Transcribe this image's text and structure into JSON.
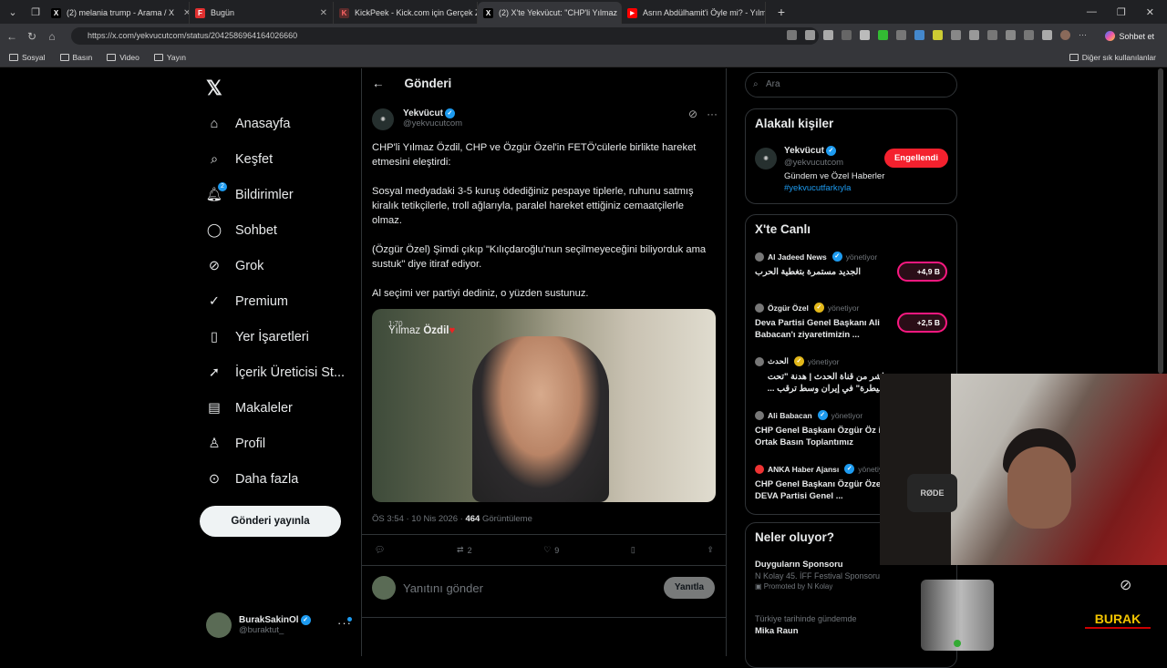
{
  "browser": {
    "tabs": [
      {
        "label": "(2) melania trump - Arama / X",
        "fav": "X"
      },
      {
        "label": "Bugün",
        "fav": "F"
      },
      {
        "label": "KickPeek - Kick.com için Gerçek Za",
        "fav": "K"
      },
      {
        "label": "(2) X'te Yekvücut: \"CHP'li Yılmaz",
        "fav": "X"
      },
      {
        "label": "Asrın Abdülhamit'i Öyle mi? - Yılm",
        "fav": "▶"
      }
    ],
    "url": "https://x.com/yekvucutcom/status/2042586964164026660",
    "chat_label": "Sohbet et",
    "bookmarks": [
      "Sosyal",
      "Basın",
      "Video",
      "Yayın"
    ],
    "bookmarks_other": "Diğer sık kullanılanlar"
  },
  "nav": {
    "items": [
      "Anasayfa",
      "Keşfet",
      "Bildirimler",
      "Sohbet",
      "Grok",
      "Premium",
      "Yer İşaretleri",
      "İçerik Üreticisi St...",
      "Makaleler",
      "Profil",
      "Daha fazla"
    ],
    "notif_badge": "2",
    "post_button": "Gönderi yayınla",
    "user_name": "BurakSakinOl",
    "user_handle": "@buraktut_"
  },
  "post": {
    "header": "Gönderi",
    "author_name": "Yekvücut",
    "author_handle": "@yekvucutcom",
    "paragraphs": [
      "CHP'li Yılmaz Özdil, CHP ve Özgür Özel'in FETÖ'cülerle birlikte hareket etmesini eleştirdi:",
      "Sosyal medyadaki 3-5 kuruş ödediğiniz pespaye tiplerle, ruhunu satmış kiralık tetikçilerle, troll ağlarıyla, paralel hareket ettiğiniz cemaatçilerle olmaz.",
      "(Özgür Özel) Şimdi çıkıp \"Kılıçdaroğlu'nun seçilmeyeceğini biliyorduk ama sustuk\" diye itiraf ediyor.",
      "Al seçimi ver partiyi dediniz, o yüzden sustunuz."
    ],
    "video_time": "1:70",
    "video_title_a": "Yılmaz",
    "video_title_b": "Özdil",
    "time": "ÖS 3:54 · 10 Nis 2026 · ",
    "views": "464",
    "views_label": " Görüntüleme",
    "retweets": "2",
    "likes": "9",
    "reply_placeholder": "Yanıtını gönder",
    "reply_button": "Yanıtla"
  },
  "right": {
    "search_placeholder": "Ara",
    "people_title": "Alakalı kişiler",
    "person_name": "Yekvücut",
    "person_handle": "@yekvucutcom",
    "person_bio": "Gündem ve Özel Haberler",
    "person_tag": "#yekvucutfarkıyla",
    "blocked_label": "Engellendi",
    "live_title": "X'te Canlı",
    "manages": "yönetiyor",
    "lives": [
      {
        "host": "Al Jadeed News",
        "title": "الجديد مستمرة بتغطية الحرب",
        "count": "+4,9 B"
      },
      {
        "host": "Özgür Özel",
        "title": "Deva Partisi Genel Başkanı Ali Babacan'ı ziyaretimizin ...",
        "count": "+2,5 B"
      },
      {
        "host": "الحدث",
        "title": "مباشر من قناة الحدث | هدنة \"تحت السيطرة\" في إيران وسط ترقب ...",
        "count": ""
      },
      {
        "host": "Ali Babacan",
        "title": "CHP Genel Başkanı Özgür Öz ile Ortak Basın Toplantımız",
        "count": ""
      },
      {
        "host": "ANKA Haber Ajansı",
        "title": "CHP Genel Başkanı Özgür Özel, DEVA Partisi Genel ...",
        "count": ""
      }
    ],
    "trends_title": "Neler oluyor?",
    "trend1_title": "Duyguların Sponsoru",
    "trend1_sub": "N Kolay 45. İFF Festival Sponsoru",
    "trend1_promo": "Promoted by N Kolay",
    "trend2_sub": "Türkiye tarihinde gündemde",
    "trend2_title": "Mika Raun"
  },
  "overlay": {
    "mic_label": "RØDE",
    "brand": "BURAK"
  }
}
